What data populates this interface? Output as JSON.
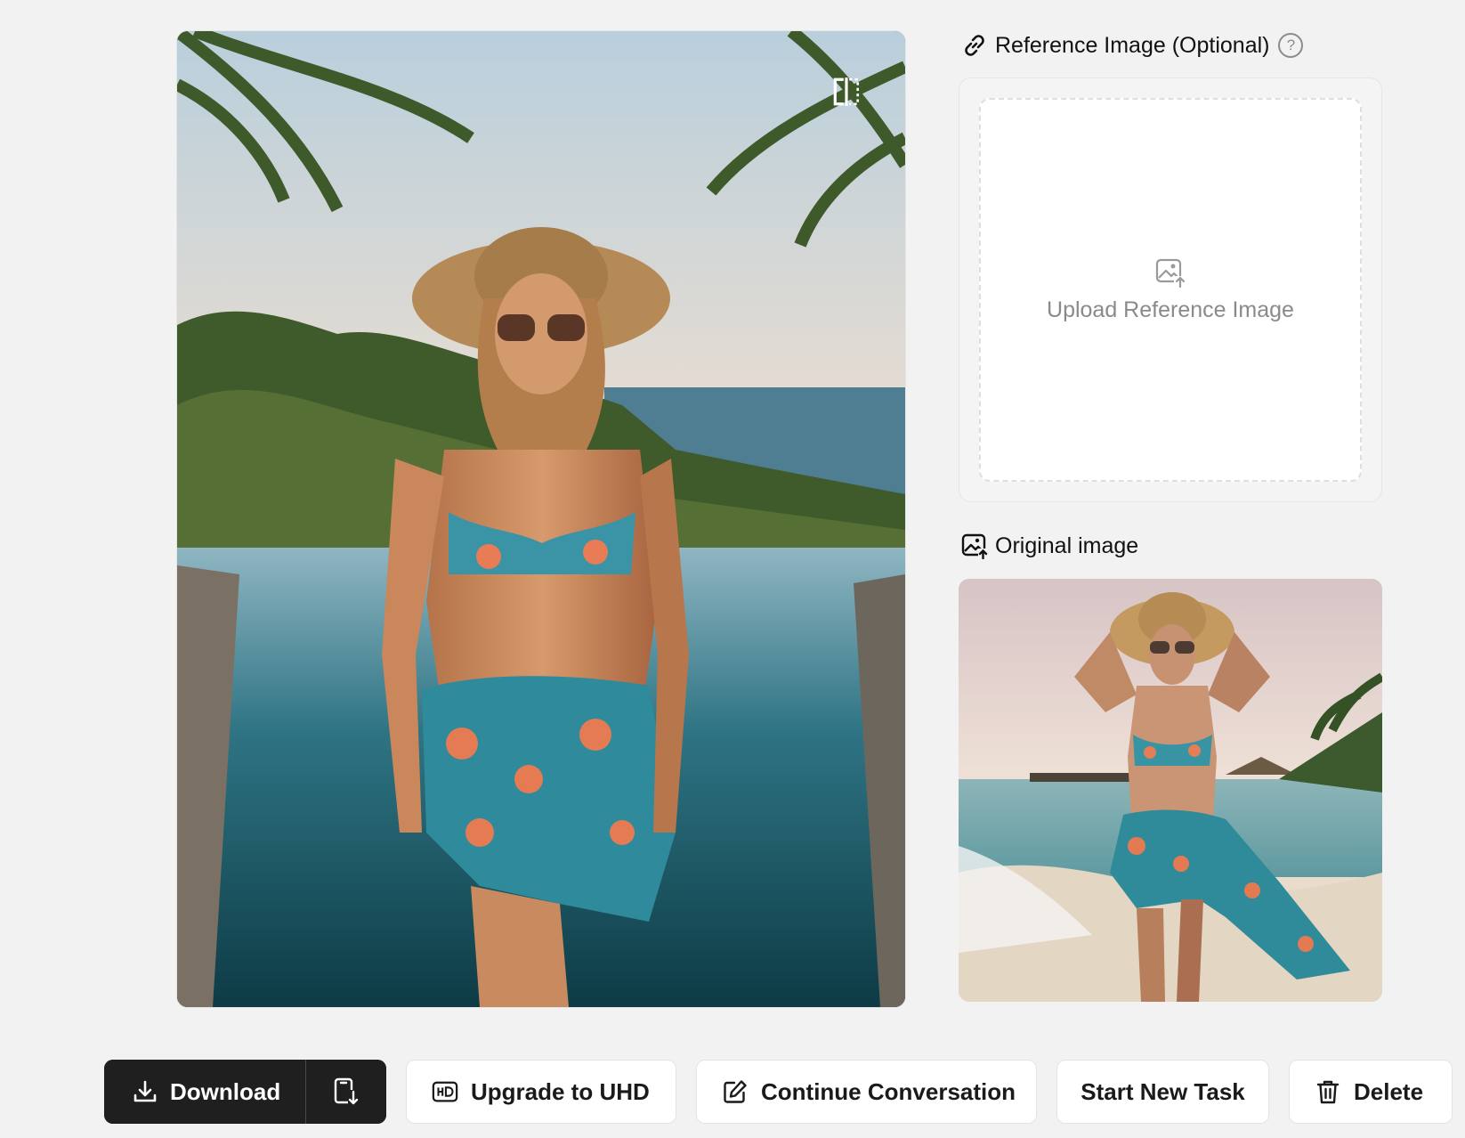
{
  "result_image": {
    "alt": "Woman in floral bikini and sarong standing in front of an infinity pool with palm trees",
    "compare_icon": "compare-split-icon"
  },
  "reference": {
    "title": "Reference Image (Optional)",
    "title_icon": "link-icon",
    "help_icon": "question-circle-icon",
    "help_glyph": "?",
    "upload_icon": "image-upload-icon",
    "upload_label": "Upload Reference Image"
  },
  "original": {
    "title": "Original image",
    "title_icon": "image-upload-icon",
    "alt": "Woman in straw hat and floral swimwear on a tropical beach"
  },
  "actions": {
    "download_label": "Download",
    "download_icon": "download-icon",
    "mobile_download_icon": "phone-download-icon",
    "upgrade_label": "Upgrade to UHD",
    "upgrade_icon": "hd-icon",
    "continue_label": "Continue Conversation",
    "continue_icon": "edit-icon",
    "new_task_label": "Start New Task",
    "delete_label": "Delete",
    "delete_icon": "trash-icon"
  },
  "colors": {
    "background": "#f2f2f2",
    "dark_button": "#1f1f1f",
    "muted_text": "#8a8a8a"
  }
}
